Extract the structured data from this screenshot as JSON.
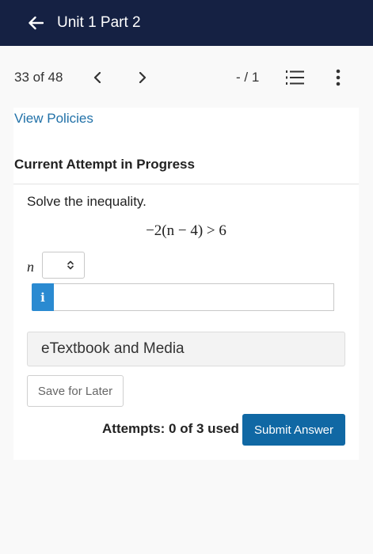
{
  "header": {
    "title": "Unit 1 Part 2",
    "back_icon": "arrow-left-icon",
    "background": "#152143"
  },
  "navigation": {
    "counter": "33 of 48",
    "prev_icon": "chevron-left-icon",
    "next_icon": "chevron-right-icon",
    "score": "- / 1",
    "list_icon": "numbered-list-icon",
    "more_icon": "more-vertical-icon"
  },
  "policies_link": "View Policies",
  "attempt": {
    "title": "Current Attempt in Progress"
  },
  "question": {
    "prompt": "Solve the inequality.",
    "expression": "−2(n − 4) > 6",
    "variable": "n",
    "select_value": "",
    "answer_value": "",
    "info_label": "i"
  },
  "resources": {
    "etextbook_label": "eTextbook and Media"
  },
  "actions": {
    "save_label": "Save for Later",
    "attempts_text": "Attempts: 0 of 3 used",
    "submit_label": "Submit Answer"
  },
  "colors": {
    "link": "#2171a8",
    "info": "#2a8ad1",
    "submit": "#1068a4"
  }
}
